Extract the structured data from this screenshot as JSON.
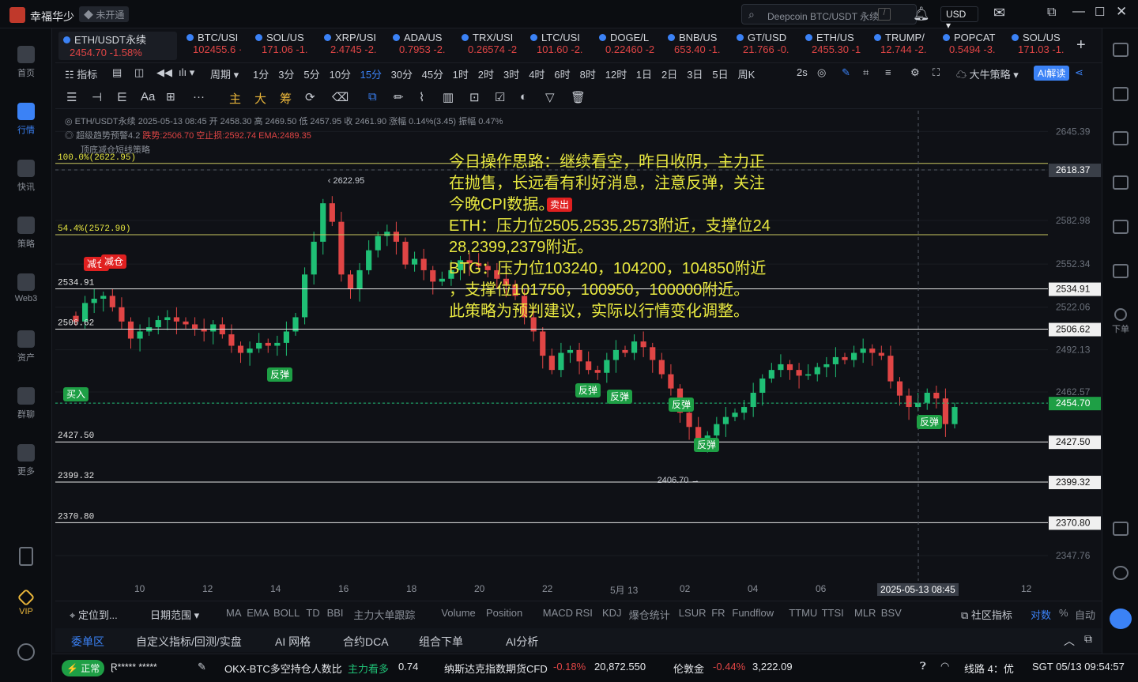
{
  "app": {
    "name": "幸福华少",
    "account_status": "未开通"
  },
  "search": {
    "placeholder": "Deepcoin BTC/USDT 永续"
  },
  "currency": "USD",
  "sidebar": {
    "items": [
      {
        "label": "首页"
      },
      {
        "label": "行情"
      },
      {
        "label": "快讯"
      },
      {
        "label": "策略"
      },
      {
        "label": "Web3"
      },
      {
        "label": "资产"
      },
      {
        "label": "群聊"
      },
      {
        "label": "更多"
      },
      {
        "label": "VIP"
      }
    ]
  },
  "rightbar": {
    "order_label": "下单"
  },
  "tickers": [
    {
      "name": "ETH/USDT永续",
      "price": "2454.70",
      "change": "-1.58%"
    },
    {
      "name": "BTC/USI",
      "price": "102455.6 ·"
    },
    {
      "name": "SOL/US",
      "price": "171.06 -1."
    },
    {
      "name": "XRP/USI",
      "price": "2.4745 -2."
    },
    {
      "name": "ADA/US",
      "price": "0.7953 -2."
    },
    {
      "name": "TRX/USI",
      "price": "0.26574 -2"
    },
    {
      "name": "LTC/USI",
      "price": "101.60 -2."
    },
    {
      "name": "DOGE/L",
      "price": "0.22460 -2"
    },
    {
      "name": "BNB/US",
      "price": "653.40 -1."
    },
    {
      "name": "GT/USD",
      "price": "21.766 -0."
    },
    {
      "name": "ETH/US",
      "price": "2455.30 -1"
    },
    {
      "name": "TRUMP/",
      "price": "12.744 -2."
    },
    {
      "name": "POPCAT",
      "price": "0.5494 -3."
    },
    {
      "name": "SOL/US",
      "price": "171.03 -1."
    }
  ],
  "toolbar": {
    "indicator": "指标",
    "period": "周期",
    "timeframes": [
      "1分",
      "3分",
      "5分",
      "10分",
      "15分",
      "30分",
      "45分",
      "1时",
      "2时",
      "3时",
      "4时",
      "6时",
      "8时",
      "12时",
      "1日",
      "2日",
      "3日",
      "5日",
      "周K"
    ],
    "active_timeframe": "15分",
    "interval": "2s",
    "strategy": "大牛策略",
    "ai_button": "AI解读",
    "draw_tools": [
      "主",
      "大",
      "筹"
    ]
  },
  "chart_info": {
    "line1": "ETH/USDT永续 2025-05-13 08:45 开 2458.30 高 2469.50 低 2457.95 收 2461.90 涨幅 0.14%(3.45) 振幅 0.47%",
    "line2a": "超级趋势预警4.2",
    "line2b": "跌势:2506.70 空止损:2592.74 EMA:2489.35",
    "line3": "顶底减仓短线策略"
  },
  "annotation": [
    "今日操作思路：继续看空，昨日收阴，主力正",
    "在抛售，长远看有利好消息，注意反弹，关注",
    "今晚CPI数据。",
    "ETH：压力位2505,2535,2573附近，支撑位24",
    "28,2399,2379附近。",
    "BTG：压力位103240，104200，104850附近",
    "，支撑位101750，100950，100000附近。",
    "此策略为预判建议，实际以行情变化调整。"
  ],
  "chart_data": {
    "type": "candlestick",
    "symbol": "ETH/USDT永续",
    "timeframe": "15分",
    "price_axis_ticks": [
      2645.39,
      2618.37,
      2582.98,
      2552.34,
      2534.91,
      2522.06,
      2506.62,
      2492.13,
      2462.57,
      2454.7,
      2427.5,
      2399.32,
      2370.8,
      2347.76
    ],
    "time_axis_ticks": [
      "10",
      "12",
      "14",
      "16",
      "18",
      "20",
      "22",
      "5月 13",
      "02",
      "04",
      "06",
      "2025-05-13 08:45",
      "12"
    ],
    "ylim": [
      2330,
      2660
    ],
    "horizontal_lines": [
      {
        "label": "100.0%(2622.95)",
        "value": 2622.95
      },
      {
        "label": "54.4%(2572.90)",
        "value": 2572.9
      },
      {
        "label": "2534.91",
        "value": 2534.91
      },
      {
        "label": "2506.62",
        "value": 2506.62
      },
      {
        "label": "2427.50",
        "value": 2427.5
      },
      {
        "label": "2399.32",
        "value": 2399.32
      },
      {
        "label": "2370.80",
        "value": 2370.8
      }
    ],
    "last_price": 2454.7,
    "crosshair_price": 2618.37,
    "high_marker": "2622.95",
    "low_marker": "2406.70",
    "signals": [
      {
        "label": "减仓",
        "color": "#e02020"
      },
      {
        "label": "减仓",
        "color": "#e02020"
      },
      {
        "label": "买入",
        "color": "#1e9f45"
      },
      {
        "label": "反弹",
        "color": "#1e9f45"
      },
      {
        "label": "卖出",
        "color": "#e02020"
      },
      {
        "label": "反弹",
        "color": "#1e9f45"
      },
      {
        "label": "反弹",
        "color": "#1e9f45"
      },
      {
        "label": "反弹",
        "color": "#1e9f45"
      },
      {
        "label": "反弹",
        "color": "#1e9f45"
      },
      {
        "label": "反弹",
        "color": "#1e9f45"
      }
    ],
    "close": [
      2512,
      2525,
      2528,
      2530,
      2522,
      2512,
      2500,
      2505,
      2508,
      2513,
      2515,
      2512,
      2510,
      2507,
      2505,
      2510,
      2503,
      2495,
      2490,
      2493,
      2497,
      2495,
      2497,
      2505,
      2515,
      2545,
      2568,
      2595,
      2582,
      2545,
      2535,
      2548,
      2562,
      2572,
      2575,
      2568,
      2552,
      2556,
      2548,
      2540,
      2542,
      2548,
      2555,
      2553,
      2551,
      2548,
      2542,
      2538,
      2530,
      2515,
      2505,
      2488,
      2478,
      2490,
      2492,
      2484,
      2478,
      2476,
      2485,
      2492,
      2490,
      2498,
      2494,
      2485,
      2475,
      2465,
      2448,
      2438,
      2425,
      2432,
      2440,
      2445,
      2448,
      2452,
      2462,
      2472,
      2478,
      2482,
      2478,
      2474,
      2475,
      2480,
      2482,
      2487,
      2485,
      2490,
      2493,
      2490,
      2488,
      2470,
      2460,
      2452,
      2455,
      2462,
      2458,
      2440,
      2452
    ]
  },
  "indicators": {
    "items": [
      "MA",
      "EMA",
      "BOLL",
      "TD",
      "BBI",
      "主力大单跟踪",
      "Volume",
      "Position",
      "MACD",
      "RSI",
      "KDJ",
      "爆仓统计",
      "LSUR",
      "FR",
      "Fundflow",
      "TTMU",
      "TTSI",
      "MLR",
      "BSV"
    ],
    "locate": "定位到...",
    "date_range": "日期范围",
    "community": "社区指标",
    "compare": "对数",
    "percent": "%",
    "auto": "自动"
  },
  "bottom_tabs": [
    "委单区",
    "自定义指标/回测/实盘",
    "AI 网格",
    "合约DCA",
    "组合下单",
    "AI分析"
  ],
  "statusbar": {
    "status": "正常",
    "user": "Ɽ***** *****",
    "ratio_label": "OKX-BTC多空持仓人数比",
    "ratio_sentiment": "主力看多",
    "ratio_value": "0.74",
    "nasdaq_label": "纳斯达克指数期货CFD",
    "nasdaq_change": "-0.18%",
    "nasdaq_value": "20,872.550",
    "gold_label": "伦敦金",
    "gold_change": "-0.44%",
    "gold_value": "3,222.09",
    "route": "线路 4：优",
    "time": "SGT 05/13 09:54:57"
  },
  "colors": {
    "up": "#1fbf75",
    "down": "#e04545",
    "accent": "#3b82f6",
    "annotation": "#e8e840"
  }
}
